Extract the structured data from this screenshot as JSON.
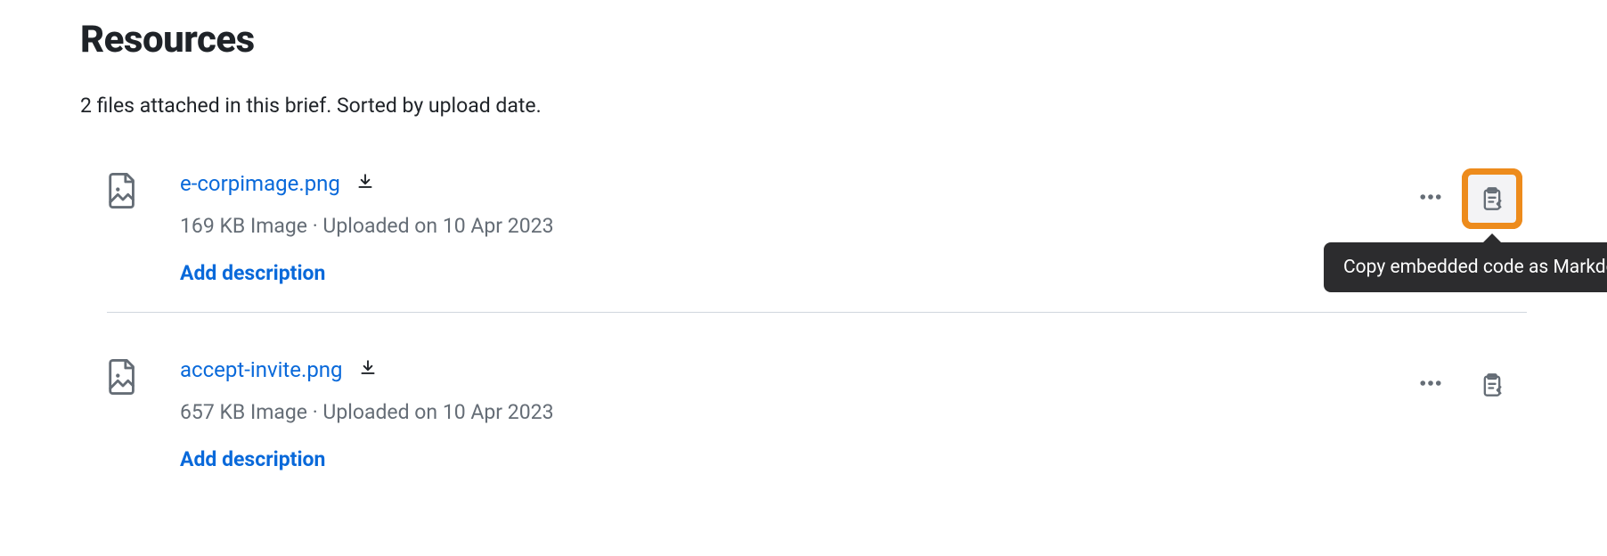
{
  "header": {
    "title": "Resources",
    "subtitle": "2 files attached in this brief. Sorted by upload date."
  },
  "files": [
    {
      "name": "e-corpimage.png",
      "meta": "169 KB Image · Uploaded on 10 Apr 2023",
      "add_desc_label": "Add description"
    },
    {
      "name": "accept-invite.png",
      "meta": "657 KB Image · Uploaded on 10 Apr 2023",
      "add_desc_label": "Add description"
    }
  ],
  "tooltip": {
    "copy_markdown": "Copy embedded code as Markdown"
  }
}
